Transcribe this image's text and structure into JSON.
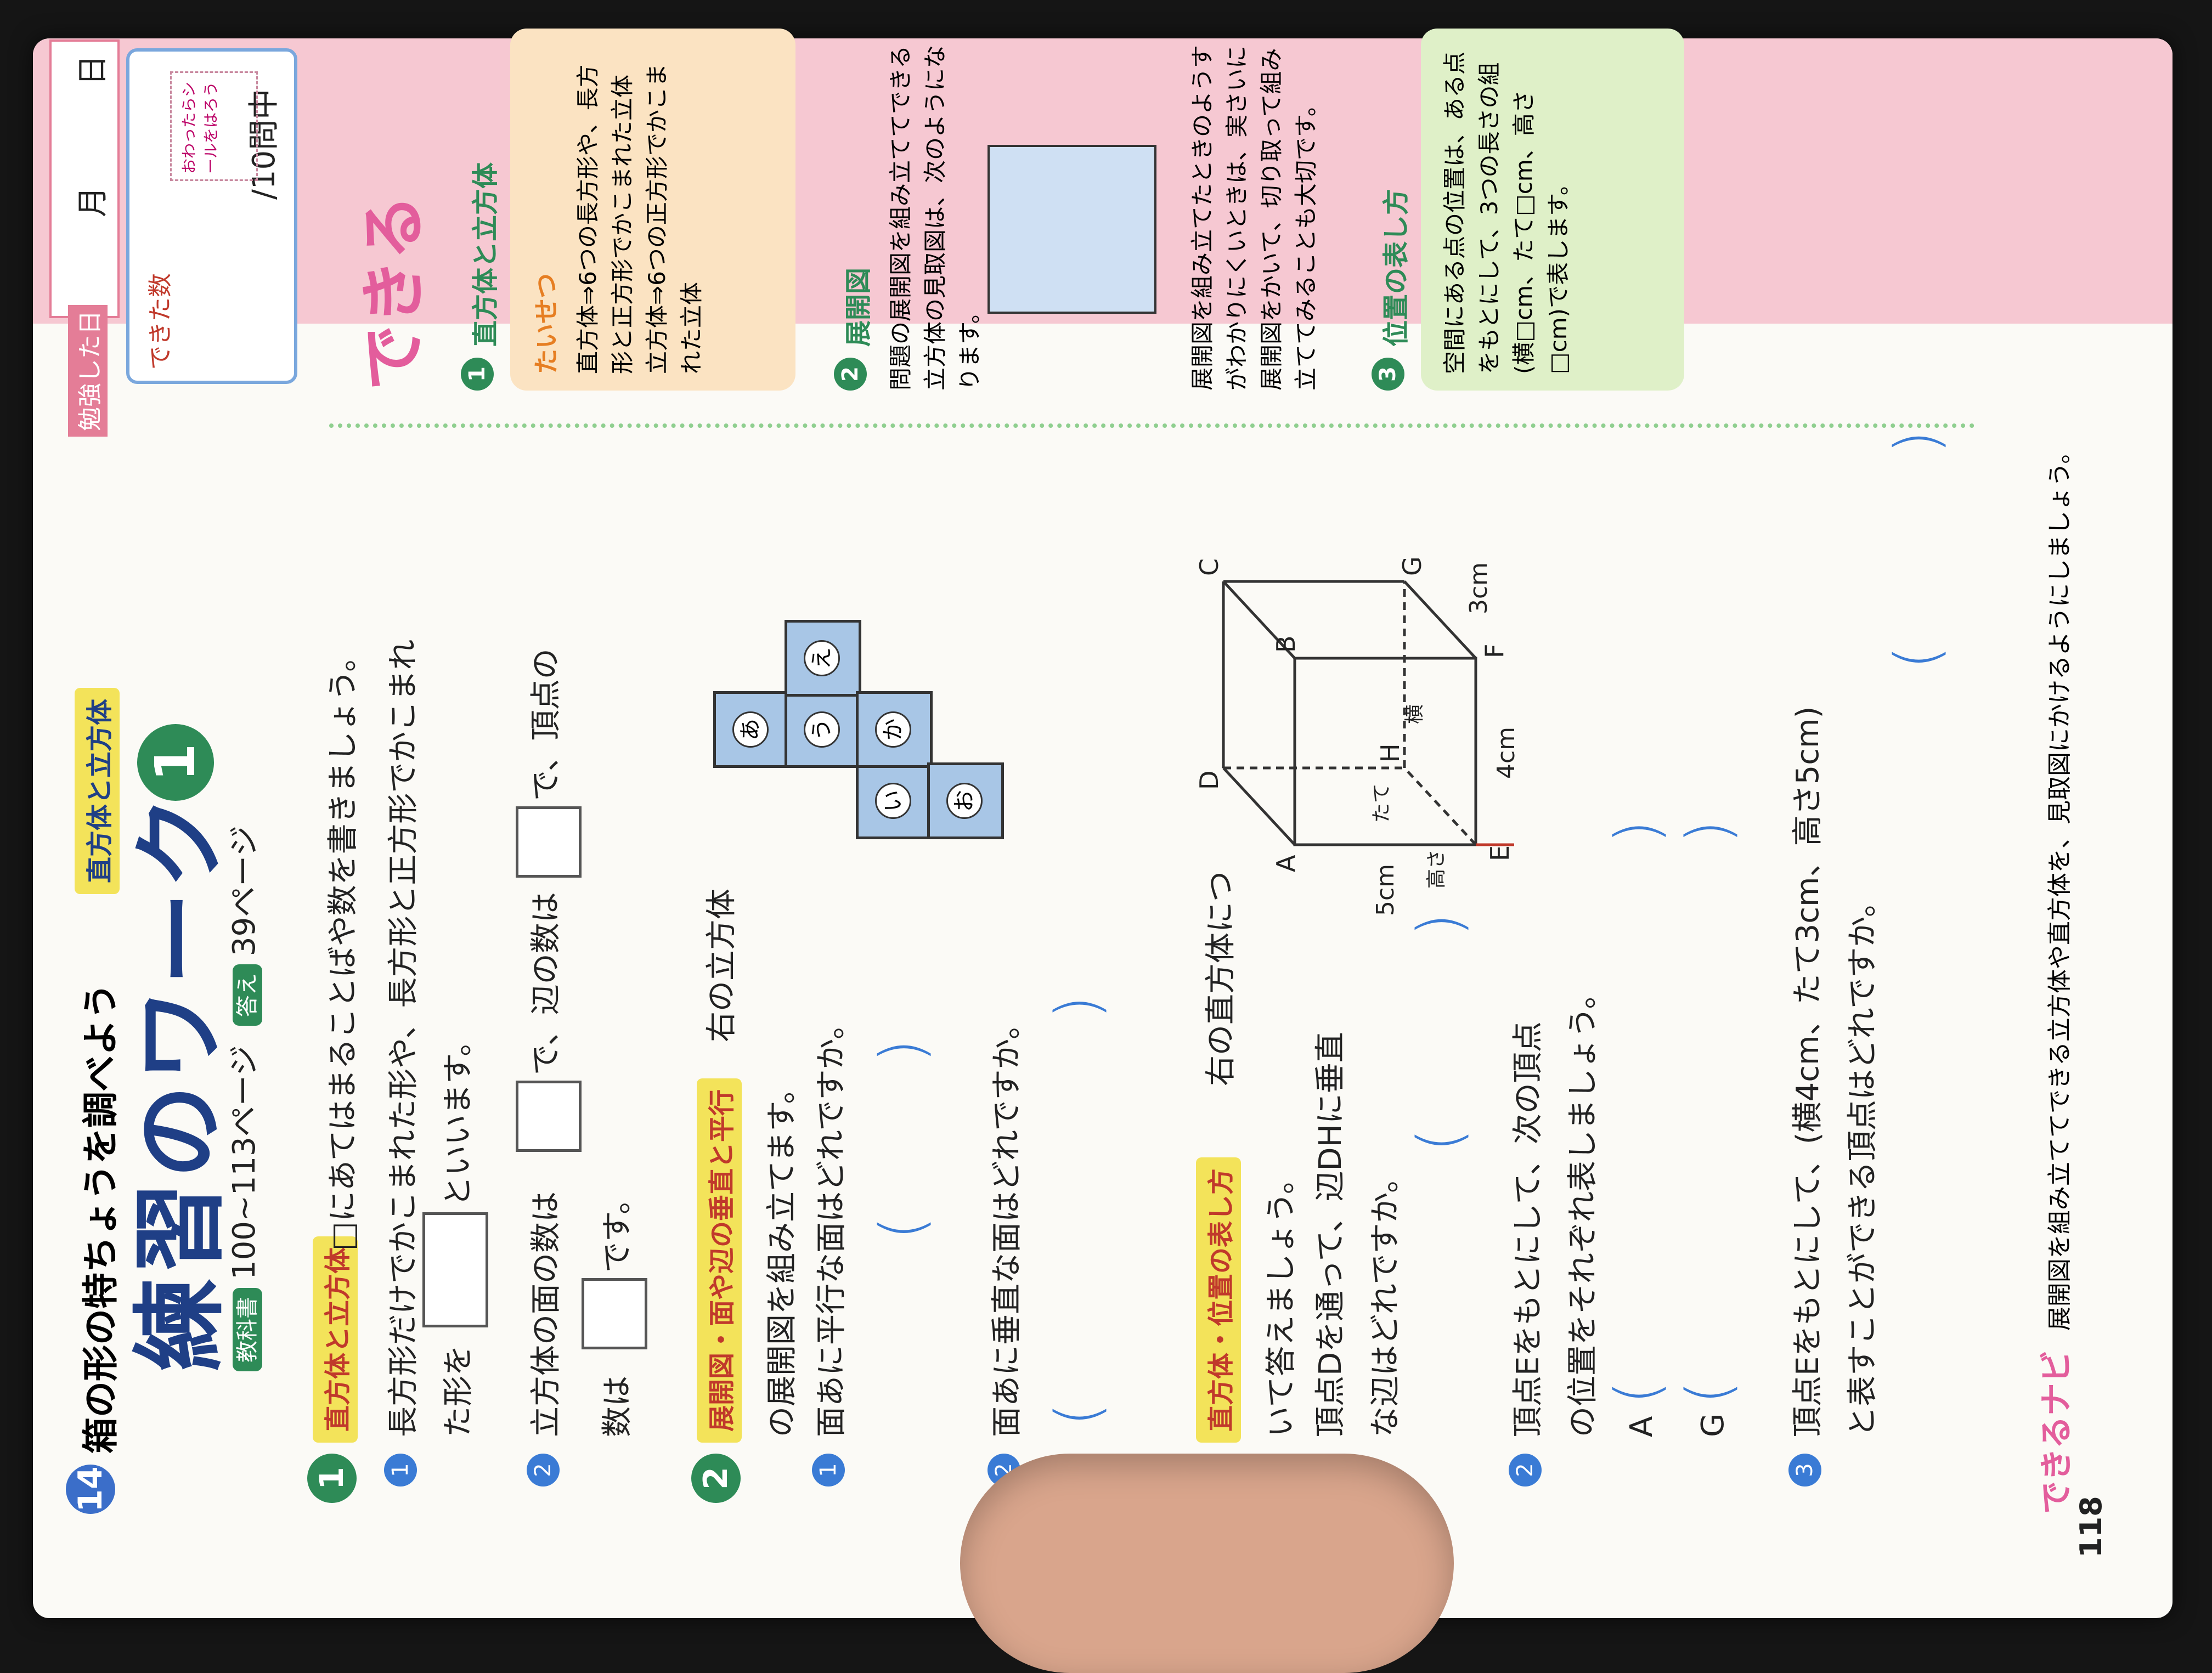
{
  "unit": {
    "number": "14",
    "title": "箱の形の特ちょうを調べよう",
    "subtitle": "直方体と立方体"
  },
  "header": {
    "title": "練習のワーク",
    "title_number": "1",
    "textbook_label": "教科書",
    "textbook_pages": "100~113ページ",
    "answer_label": "答え",
    "answer_page": "39ページ",
    "study_date_label": "勉強した日",
    "month_label": "月",
    "day_label": "日",
    "done_label": "できた数",
    "score_label": "/10問中",
    "sticker_label": "おわったらシールをはろう"
  },
  "sections": {
    "s1": {
      "no": "1",
      "tag": "直方体と立方体",
      "intro": "□にあてはまることばや数を書きましょう。",
      "q1a": "長方形だけでかこまれた形や、長方形と正方形でかこまれ",
      "q1b": "た形を",
      "q1c": "といいます。",
      "q2a": "立方体の面の数は",
      "q2b": "で、辺の数は",
      "q2c": "で、頂点の",
      "q2d": "数は",
      "q2e": "です。"
    },
    "s2": {
      "no": "2",
      "tag": "展開図・面や辺の垂直と平行",
      "intro_a": "右の立方体",
      "intro_b": "の展開図を組み立てます。",
      "q1": "面あに平行な面はどれですか。",
      "q2": "面あに垂直な面はどれですか。"
    },
    "s3": {
      "no": "3",
      "tag": "直方体・位置の表し方",
      "intro_a": "右の直方体につ",
      "intro_b": "いて答えましょう。",
      "q1a": "頂点Dを通って、辺DHに垂直",
      "q1b": "な辺はどれですか。",
      "q2a": "頂点Eをもとにして、次の頂点",
      "q2b": "の位置をそれぞれ表しましょう。",
      "pointA": "A",
      "pointG": "G",
      "q3a": "頂点Eをもとにして、(横4cm、たて3cm、高さ5cm)",
      "q3b": "と表すことができる頂点はどれですか。"
    }
  },
  "net_faces": [
    "あ",
    "い",
    "う",
    "え",
    "お",
    "か"
  ],
  "box_labels": {
    "A": "A",
    "B": "B",
    "C": "C",
    "D": "D",
    "E": "E",
    "F": "F",
    "G": "G",
    "H": "H",
    "dim_w": "4cm",
    "dim_d": "3cm",
    "dim_h": "5cm",
    "axis_w": "横",
    "axis_d": "たて",
    "axis_h": "高さ"
  },
  "sidebar": {
    "logo": "できる",
    "t1": "直方体と立方体",
    "taisetsu": "たいせつ",
    "t1_body": "直方体⇒6つの長方形や、長方形と正方形でかこまれた立体 立方体⇒6つの正方形でかこまれた立体",
    "t2": "展開図",
    "t2_body": "問題の展開図を組み立ててできる立方体の見取図は、次のようになります。",
    "t2_note": "展開図を組み立てたときのようすがわかりにくいときは、実さいに展開図をかいて、切り取って組み立ててみることも大切です。",
    "t3": "位置の表し方",
    "t3_body": "空間にある点の位置は、ある点をもとにして、3つの長さの組(横□cm、たて□cm、高さ□cm)で表します。"
  },
  "footer": {
    "navi": "できるナビ",
    "text": "展開図を組み立ててできる立方体や直方体を、見取図にかけるようにしましょう。",
    "page": "118"
  }
}
